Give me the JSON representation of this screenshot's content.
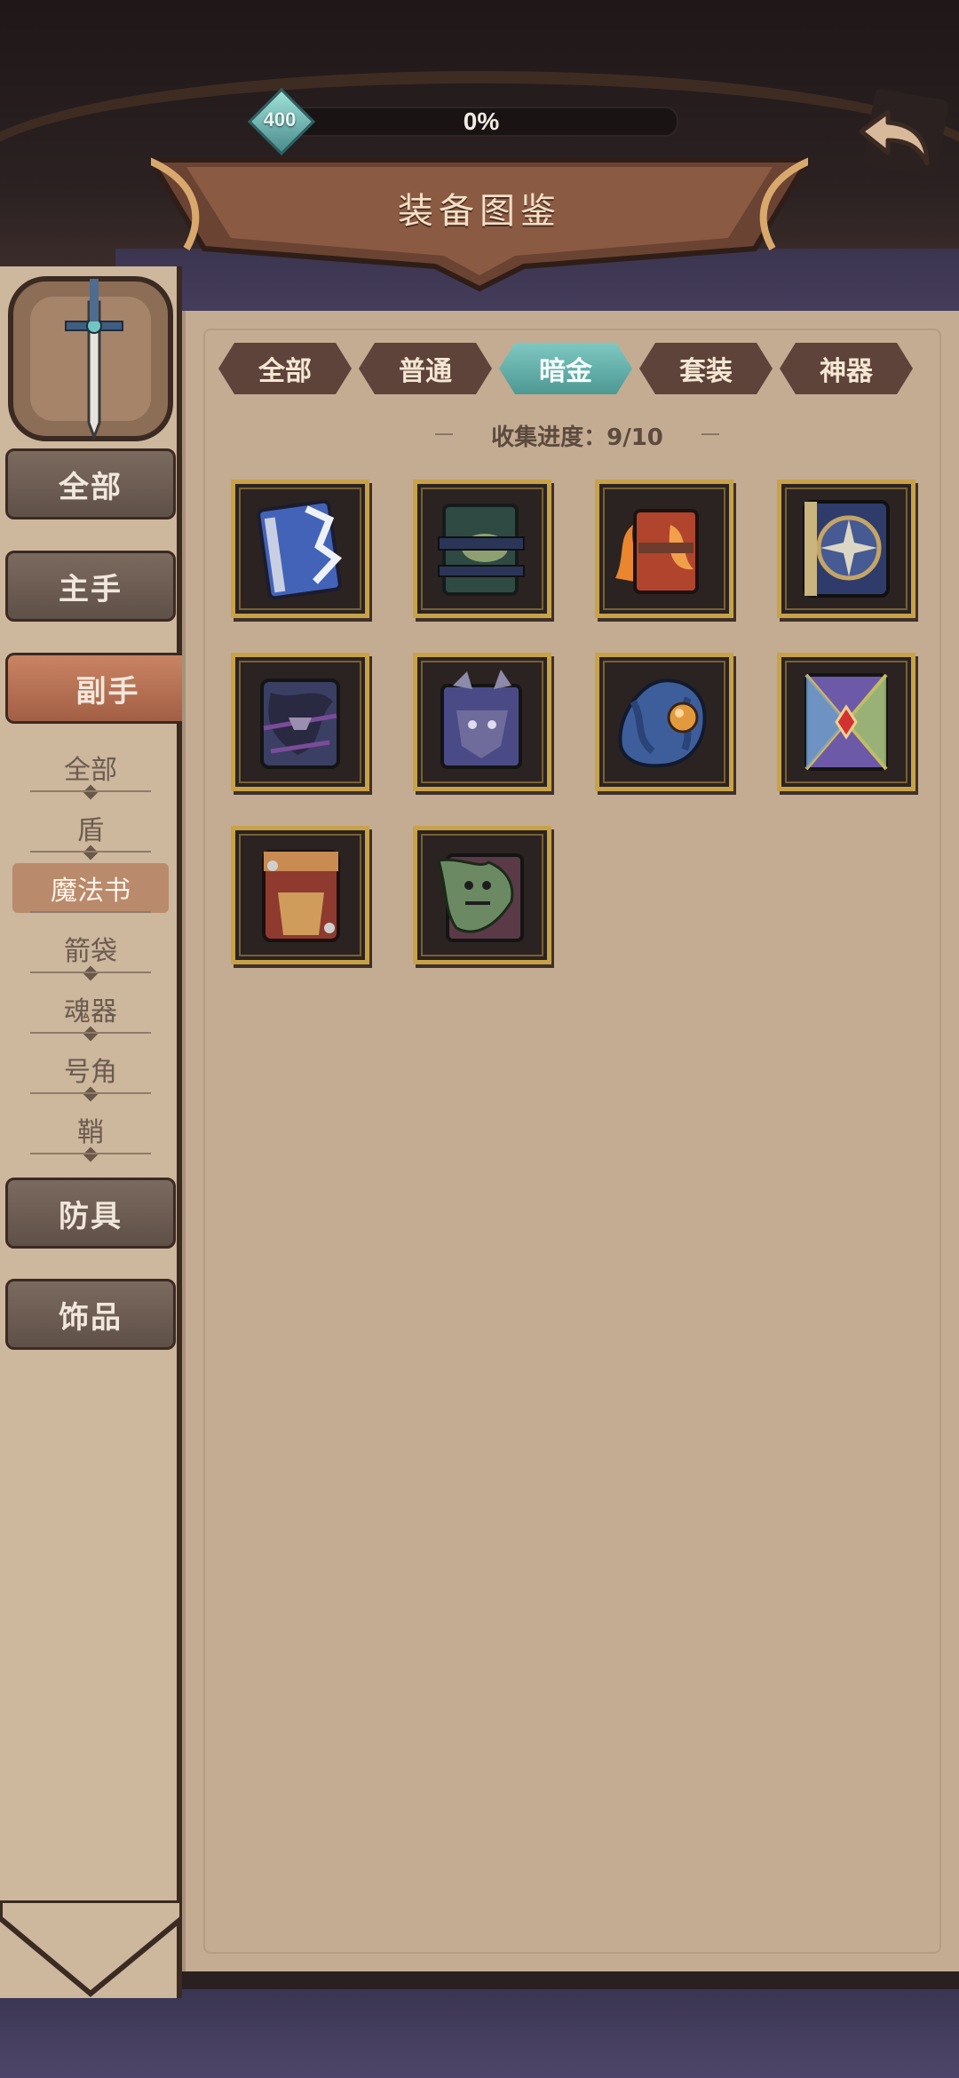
{
  "header": {
    "level": "400",
    "progress_text": "0%",
    "progress_fraction": 0,
    "title": "装备图鉴"
  },
  "tabs": [
    {
      "label": "全部",
      "active": false
    },
    {
      "label": "普通",
      "active": false
    },
    {
      "label": "暗金",
      "active": true
    },
    {
      "label": "套装",
      "active": false
    },
    {
      "label": "神器",
      "active": false
    }
  ],
  "collect_progress": "收集进度：9/10",
  "sidebar": {
    "categories": [
      {
        "label": "全部"
      },
      {
        "label": "主手"
      },
      {
        "label": "副手"
      },
      {
        "label": "防具"
      },
      {
        "label": "饰品"
      }
    ],
    "sub_items": [
      {
        "label": "全部"
      },
      {
        "label": "盾"
      },
      {
        "label": "魔法书"
      },
      {
        "label": "箭袋"
      },
      {
        "label": "魂器"
      },
      {
        "label": "号角"
      },
      {
        "label": "鞘"
      }
    ]
  },
  "items": [
    {
      "icon": "blue-crystal-book-icon"
    },
    {
      "icon": "dark-green-bound-book-icon"
    },
    {
      "icon": "flaming-red-book-icon"
    },
    {
      "icon": "compass-star-book-icon"
    },
    {
      "icon": "shadow-thorn-book-icon"
    },
    {
      "icon": "purple-horned-book-icon"
    },
    {
      "icon": "orb-tentacle-book-icon"
    },
    {
      "icon": "stained-glass-book-icon"
    },
    {
      "icon": "red-leather-book-icon"
    },
    {
      "icon": "green-ghoul-book-icon"
    }
  ],
  "colors": {
    "panel": "#c3ac92",
    "active_tab": "#5ea9a4",
    "frame_gold": "#c7a249",
    "active_category": "#b96e51"
  }
}
